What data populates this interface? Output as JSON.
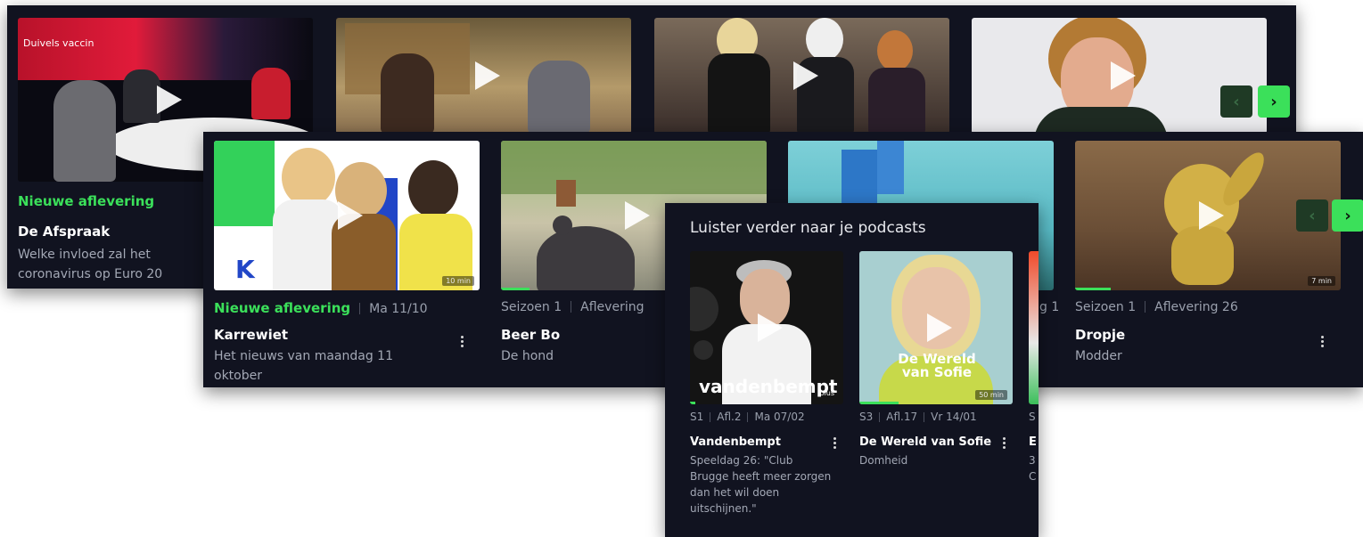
{
  "back_row": {
    "card1": {
      "thumb_text": "Duivels vaccin",
      "badge": "Nieuwe aflevering",
      "title": "De Afspraak",
      "description": "Welke invloed zal het coronavirus op Euro 20"
    }
  },
  "mid_row": {
    "cards": [
      {
        "badge": "Nieuwe aflevering",
        "date": "Ma 11/10",
        "title": "Karrewiet",
        "description": "Het nieuws van maandag 11 oktober",
        "duration": "10 min"
      },
      {
        "season": "Seizoen 1",
        "episode": "Aflevering",
        "title": "Beer Bo",
        "description": "De hond"
      },
      {
        "season_partial": "g 1"
      },
      {
        "season": "Seizoen 1",
        "episode": "Aflevering 26",
        "title": "Dropje",
        "description": "Modder",
        "duration": "7 min"
      }
    ]
  },
  "podcasts": {
    "heading": "Luister verder naar je podcasts",
    "cards": [
      {
        "cover_text": "vandenbempt",
        "cover_sub": "plus",
        "season": "S1",
        "episode": "Afl.2",
        "date": "Ma 07/02",
        "title": "Vandenbempt",
        "description": "Speeldag 26: \"Club Brugge heeft meer zorgen dan het wil doen uitschijnen.\""
      },
      {
        "cover_text": "De Wereld van Sofie",
        "duration": "50 min",
        "season": "S3",
        "episode": "Afl.17",
        "date": "Vr 14/01",
        "title": "De Wereld van Sofie",
        "description": "Domheid"
      },
      {
        "season_partial": "S",
        "title_partial": "E",
        "desc_partial_1": "3",
        "desc_partial_2": "C"
      }
    ]
  },
  "controls": {
    "prev_label": "‹",
    "next_label": "›"
  }
}
